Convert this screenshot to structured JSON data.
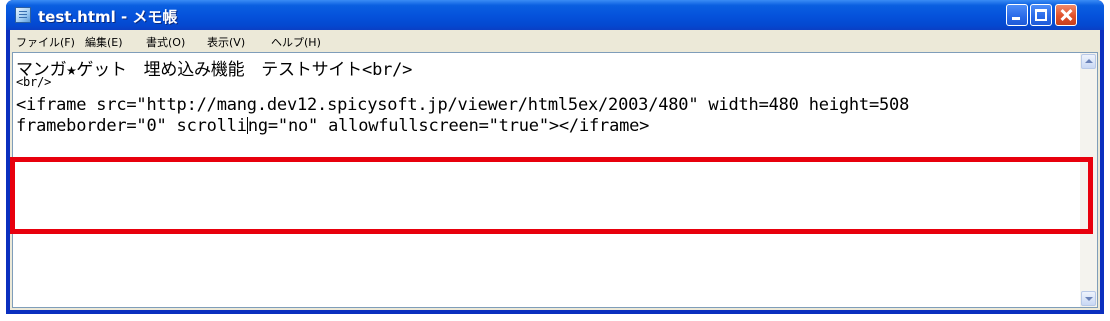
{
  "window": {
    "title": "test.html - メモ帳",
    "icon": "notepad-icon"
  },
  "menu": {
    "items": [
      "ファイル(F)",
      "編集(E)",
      "書式(O)",
      "表示(V)",
      "ヘルプ(H)"
    ]
  },
  "document": {
    "line1": "マンガ★ゲット　埋め込み機能　テストサイト<br/>",
    "line2": "<br/>",
    "line3": "    <iframe src=\"http://mang.dev12.spicysoft.jp/viewer/html5ex/2003/480\" width=480 height=508",
    "line4_before_caret": "frameborder=\"0\" scrolli",
    "line4_after_caret": "ng=\"no\" allowfullscreen=\"true\"></iframe>"
  },
  "colors": {
    "title_bar": "#0553dc",
    "highlight": "#e8000d",
    "menu_bg": "#ece9d8"
  }
}
